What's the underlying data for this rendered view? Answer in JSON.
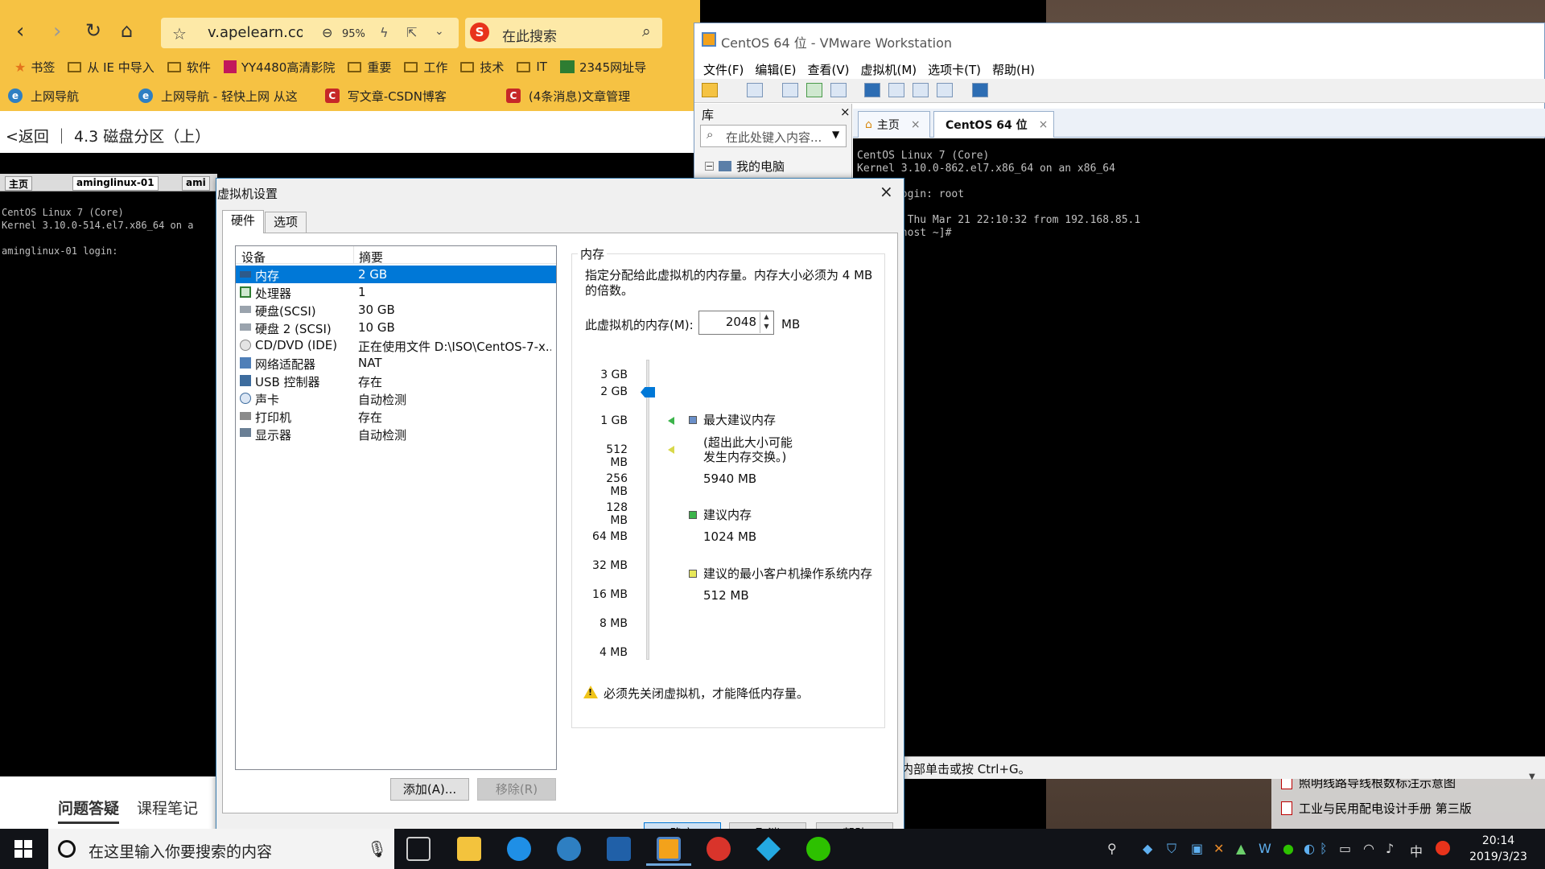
{
  "browser": {
    "url": "v.apelearn.com",
    "zoom": "95%",
    "search_placeholder": "在此搜索",
    "search_logo": "S",
    "bookmarks": [
      "书签",
      "从 IE 中导入",
      "软件",
      "YY4480高清影院",
      "重要",
      "工作",
      "技术",
      "IT",
      "2345网址导"
    ],
    "tabs": [
      "上网导航",
      "上网导航 - 轻快上网 从这",
      "写文章-CSDN博客",
      "(4条消息)文章管理"
    ],
    "page_back": "<返回",
    "page_title": "4.3 磁盘分区（上）",
    "video_tabs": [
      "主页",
      "aminglinux-01",
      "ami"
    ],
    "video_console": "CentOS Linux 7 (Core)\nKernel 3.10.0-514.el7.x86_64 on a\n\naminglinux-01 login:",
    "bottom_tabs": [
      "问题答疑",
      "课程笔记"
    ]
  },
  "desktop": {
    "files": [
      "照明线路导线根数标注示意图",
      "工业与民用配电设计手册 第三版"
    ]
  },
  "vmware": {
    "title": "CentOS 64 位 - VMware Workstation",
    "menu": [
      "文件(F)",
      "编辑(E)",
      "查看(V)",
      "虚拟机(M)",
      "选项卡(T)",
      "帮助(H)"
    ],
    "library": {
      "title": "库",
      "close": "×",
      "search_placeholder": "在此处键入内容...",
      "tree_root": "我的电脑"
    },
    "tabs": [
      {
        "label": "主页"
      },
      {
        "label": "CentOS 64 位"
      }
    ],
    "tab_close": "×",
    "console": "CentOS Linux 7 (Core)\nKernel 3.10.0-862.el7.x86_64 on an x86_64\n\n   st login: root\n   d:\n   gin: Thu Mar 21 22:10:32 from 192.168.85.1\n   ocalhost ~]#",
    "status": "内部单击或按 Ctrl+G。"
  },
  "dialog": {
    "title": "虚拟机设置",
    "close": "×",
    "tabs": [
      "硬件",
      "选项"
    ],
    "device_header": "设备",
    "summary_header": "摘要",
    "devices": [
      {
        "name": "内存",
        "summary": "2 GB",
        "icon": "memory-icon"
      },
      {
        "name": "处理器",
        "summary": "1",
        "icon": "cpu-icon"
      },
      {
        "name": "硬盘(SCSI)",
        "summary": "30 GB",
        "icon": "disk-icon"
      },
      {
        "name": "硬盘 2 (SCSI)",
        "summary": "10 GB",
        "icon": "disk-icon"
      },
      {
        "name": "CD/DVD (IDE)",
        "summary": "正在使用文件 D:\\ISO\\CentOS-7-x...",
        "icon": "cd-icon"
      },
      {
        "name": "网络适配器",
        "summary": "NAT",
        "icon": "network-icon"
      },
      {
        "name": "USB 控制器",
        "summary": "存在",
        "icon": "usb-icon"
      },
      {
        "name": "声卡",
        "summary": "自动检测",
        "icon": "sound-icon"
      },
      {
        "name": "打印机",
        "summary": "存在",
        "icon": "printer-icon"
      },
      {
        "name": "显示器",
        "summary": "自动检测",
        "icon": "monitor-icon"
      }
    ],
    "add_button": "添加(A)...",
    "remove_button": "移除(R)",
    "footer_buttons": [
      "确定",
      "取消",
      "帮助"
    ],
    "memory": {
      "group_title": "内存",
      "description": "指定分配给此虚拟机的内存量。内存大小必须为 4 MB 的倍数。",
      "label": "此虚拟机的内存(M):",
      "value": "2048",
      "unit": "MB",
      "ticks": [
        "3 GB",
        "2 GB",
        "1 GB",
        "512 MB",
        "256 MB",
        "128 MB",
        "64 MB",
        "32 MB",
        "16 MB",
        "8 MB",
        "4 MB"
      ],
      "max_label": "最大建议内存",
      "max_note_1": "(超出此大小可能",
      "max_note_2": "发生内存交换。)",
      "max_value": "5940 MB",
      "rec_label": "建议内存",
      "rec_value": "1024 MB",
      "min_label": "建议的最小客户机操作系统内存",
      "min_value": "512 MB",
      "warning": "必须先关闭虚拟机，才能降低内存量。",
      "colors": {
        "max": "#6a8fc8",
        "rec": "#3cb44b",
        "min": "#e8e85a",
        "thumb": "#0078d7"
      }
    }
  },
  "taskbar": {
    "search_placeholder": "在这里输入你要搜索的内容",
    "ime": "中",
    "time": "20:14",
    "date": "2019/3/23"
  }
}
